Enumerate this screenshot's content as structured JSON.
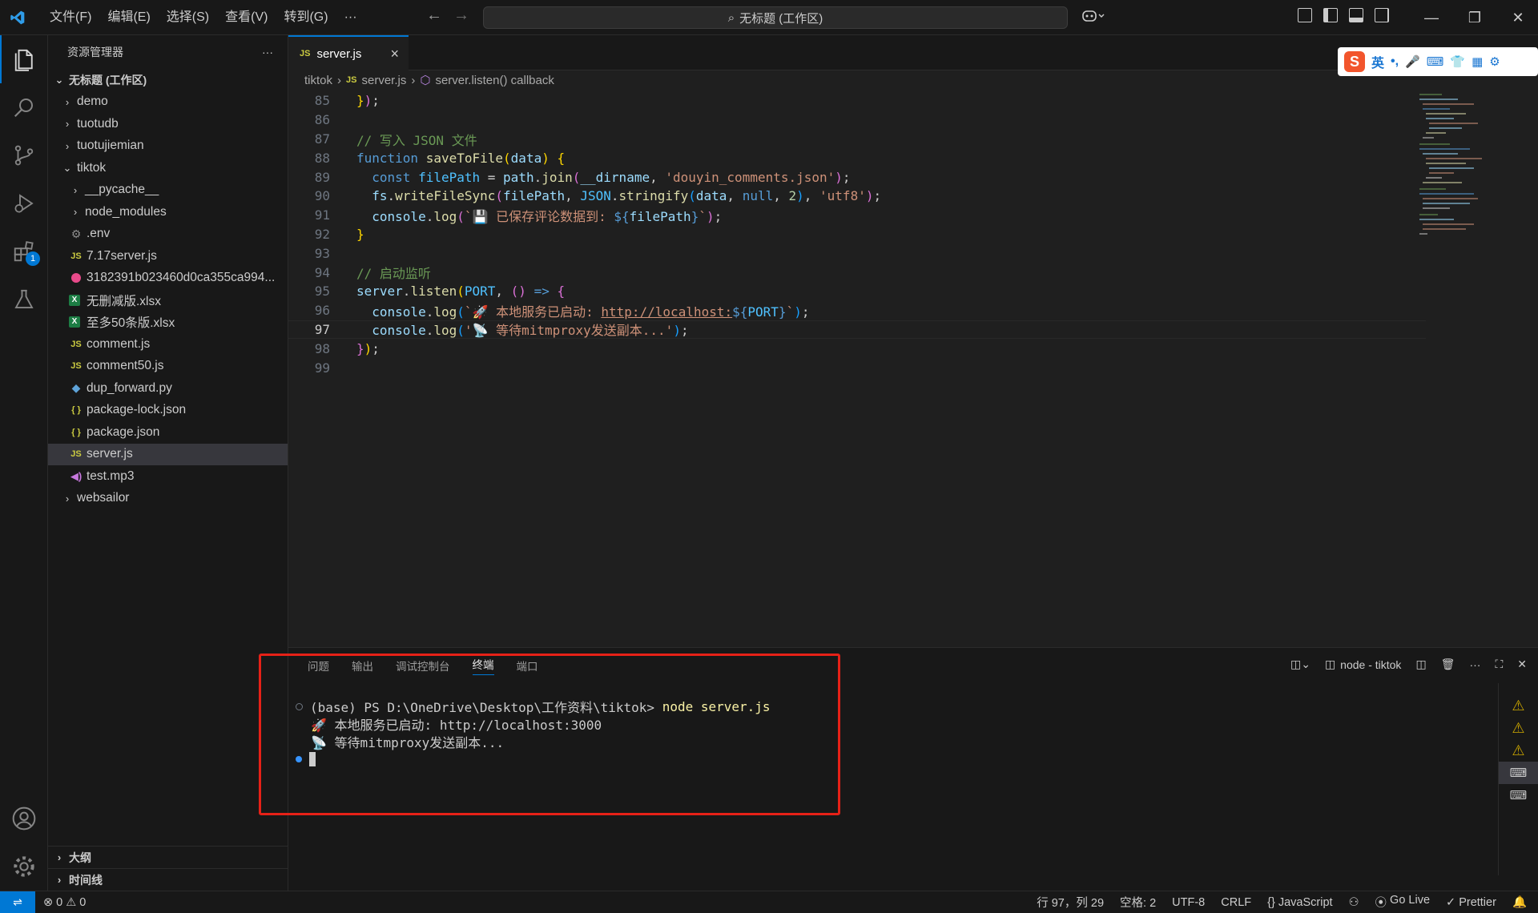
{
  "menu": [
    "文件(F)",
    "编辑(E)",
    "选择(S)",
    "查看(V)",
    "转到(G)",
    "···"
  ],
  "command_center": "无标题 (工作区)",
  "sidebar": {
    "title": "资源管理器",
    "more": "···",
    "root": "无标题 (工作区)",
    "items": [
      {
        "label": "demo",
        "type": "folder",
        "depth": 1,
        "icon": "chevron-right-icon"
      },
      {
        "label": "tuotudb",
        "type": "folder",
        "depth": 1,
        "icon": "chevron-right-icon"
      },
      {
        "label": "tuotujiemian",
        "type": "folder",
        "depth": 1,
        "icon": "chevron-right-icon"
      },
      {
        "label": "tiktok",
        "type": "folder-open",
        "depth": 1,
        "icon": "chevron-down-icon"
      },
      {
        "label": "__pycache__",
        "type": "folder",
        "depth": 2,
        "icon": "chevron-right-icon"
      },
      {
        "label": "node_modules",
        "type": "folder",
        "depth": 2,
        "icon": "chevron-right-icon"
      },
      {
        "label": ".env",
        "type": "file",
        "depth": 2,
        "icon": "gear-icon"
      },
      {
        "label": "7.17server.js",
        "type": "file",
        "depth": 2,
        "icon": "js-icon"
      },
      {
        "label": "3182391b023460d0ca355ca994...",
        "type": "file",
        "depth": 2,
        "icon": "binary-icon"
      },
      {
        "label": "无删减版.xlsx",
        "type": "file",
        "depth": 2,
        "icon": "excel-icon"
      },
      {
        "label": "至多50条版.xlsx",
        "type": "file",
        "depth": 2,
        "icon": "excel-icon"
      },
      {
        "label": "comment.js",
        "type": "file",
        "depth": 2,
        "icon": "js-icon"
      },
      {
        "label": "comment50.js",
        "type": "file",
        "depth": 2,
        "icon": "js-icon"
      },
      {
        "label": "dup_forward.py",
        "type": "file",
        "depth": 2,
        "icon": "python-icon"
      },
      {
        "label": "package-lock.json",
        "type": "file",
        "depth": 2,
        "icon": "json-icon"
      },
      {
        "label": "package.json",
        "type": "file",
        "depth": 2,
        "icon": "json-icon"
      },
      {
        "label": "server.js",
        "type": "file",
        "depth": 2,
        "icon": "js-icon",
        "selected": true
      },
      {
        "label": "test.mp3",
        "type": "file",
        "depth": 2,
        "icon": "audio-icon"
      },
      {
        "label": "websailor",
        "type": "folder",
        "depth": 1,
        "icon": "chevron-right-icon"
      }
    ],
    "outline": "大纲",
    "timeline": "时间线"
  },
  "editor": {
    "tab_label": "server.js",
    "tab_icon_text": "JS",
    "breadcrumb": [
      "tiktok",
      "server.js",
      "server.listen() callback"
    ],
    "current_line": 97,
    "lines": [
      {
        "n": "85",
        "text": "});"
      },
      {
        "n": "86",
        "text": ""
      },
      {
        "n": "87",
        "text": "// 写入 JSON 文件"
      },
      {
        "n": "88",
        "text": "function saveToFile(data) {"
      },
      {
        "n": "89",
        "text": "  const filePath = path.join(__dirname, 'douyin_comments.json');"
      },
      {
        "n": "90",
        "text": "  fs.writeFileSync(filePath, JSON.stringify(data, null, 2), 'utf8');"
      },
      {
        "n": "91",
        "text": "  console.log(`💾 已保存评论数据到: ${filePath}`);"
      },
      {
        "n": "92",
        "text": "}"
      },
      {
        "n": "93",
        "text": ""
      },
      {
        "n": "94",
        "text": "// 启动监听"
      },
      {
        "n": "95",
        "text": "server.listen(PORT, () => {"
      },
      {
        "n": "96",
        "text": "  console.log(`🚀 本地服务已启动: http://localhost:${PORT}`);"
      },
      {
        "n": "97",
        "text": "  console.log('📡 等待mitmproxy发送副本...');"
      },
      {
        "n": "98",
        "text": "});"
      },
      {
        "n": "99",
        "text": ""
      }
    ]
  },
  "ime": {
    "mode": "英",
    "punct": "•,"
  },
  "panel": {
    "tabs": [
      "问题",
      "输出",
      "调试控制台",
      "终端",
      "端口"
    ],
    "active_tab": "终端",
    "terminal_name": "node - tiktok",
    "terminal_lines": [
      "(base) PS D:\\OneDrive\\Desktop\\工作资料\\tiktok> node server.js",
      "🚀 本地服务已启动: http://localhost:3000",
      "📡 等待mitmproxy发送副本..."
    ],
    "prompt_prefix": "(base) PS D:\\OneDrive\\Desktop\\工作资料\\tiktok> ",
    "prompt_cmd": "node server.js"
  },
  "statusbar": {
    "errors": "0",
    "warnings": "0",
    "position": "行 97，列 29",
    "spaces": "空格: 2",
    "encoding": "UTF-8",
    "eol": "CRLF",
    "language": "{} JavaScript",
    "golive": "Go Live",
    "prettier": "Prettier"
  },
  "colors": {
    "accent": "#0078d4",
    "highlight_box": "#e62117"
  }
}
